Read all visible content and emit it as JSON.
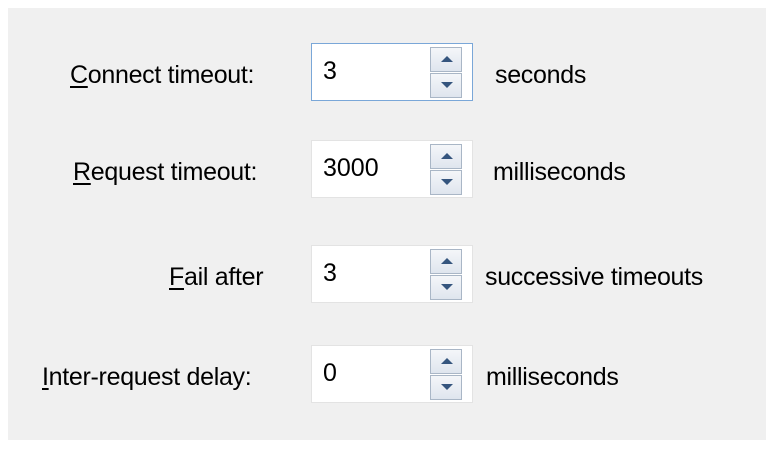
{
  "settings": {
    "connect_timeout": {
      "mnemonic": "C",
      "label_rest": "onnect timeout:",
      "value": "3",
      "unit": "seconds"
    },
    "request_timeout": {
      "mnemonic": "R",
      "label_rest": "equest timeout:",
      "value": "3000",
      "unit": "milliseconds"
    },
    "fail_after": {
      "mnemonic": "F",
      "label_rest": "ail after",
      "value": "3",
      "unit": "successive timeouts"
    },
    "inter_request_delay": {
      "mnemonic": "I",
      "label_rest": "nter-request delay:",
      "value": "0",
      "unit": "milliseconds"
    }
  },
  "icons": {
    "spin_up": "spin-up-arrow-icon",
    "spin_down": "spin-down-arrow-icon"
  },
  "colors": {
    "panel_bg": "#f0f0f0",
    "focus_border": "#7aa7d8",
    "arrow": "#35557e"
  }
}
